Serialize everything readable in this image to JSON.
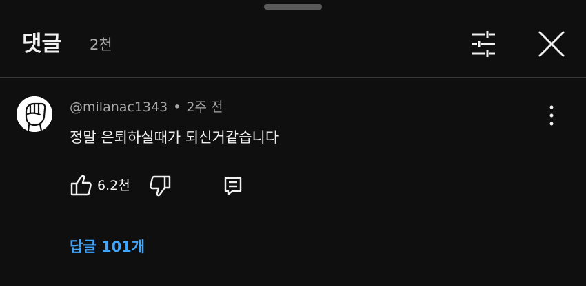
{
  "header": {
    "title": "댓글",
    "count": "2천"
  },
  "icons": {
    "filter": "filter-sliders-icon",
    "close": "close-icon",
    "more": "more-vert-icon",
    "like": "thumb-up-icon",
    "dislike": "thumb-down-icon",
    "reply": "comment-reply-icon"
  },
  "comment": {
    "author": "@milanac1343",
    "separator": "•",
    "time": "2주 전",
    "text": "정말 은퇴하실때가 되신거같습니다",
    "likes": "6.2천",
    "replies_label": "답글 101개"
  },
  "colors": {
    "background": "#0f0f0f",
    "text_primary": "#f1f1f1",
    "text_secondary": "#aaaaaa",
    "link": "#3ea6ff",
    "divider": "#3a3a3a"
  }
}
